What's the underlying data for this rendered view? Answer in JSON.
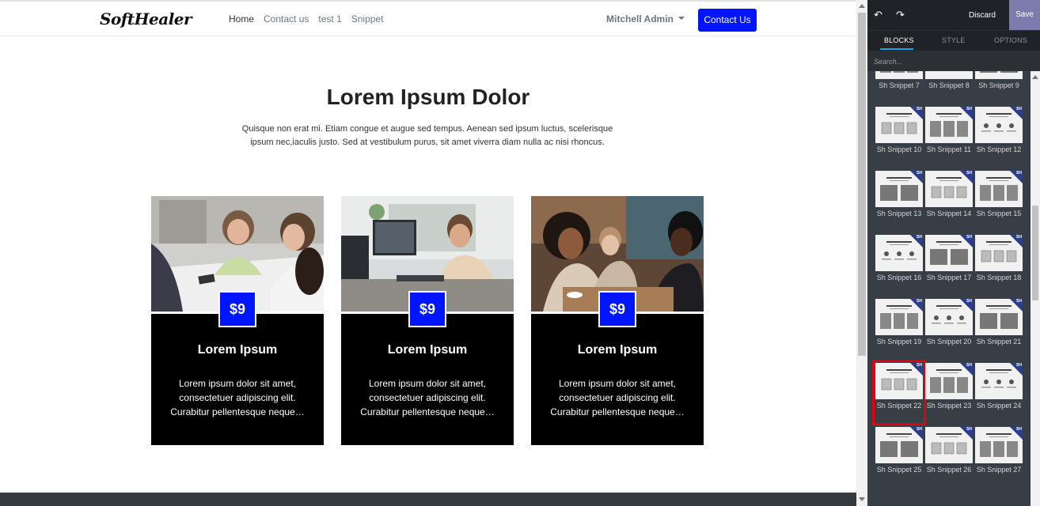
{
  "navbar": {
    "logo": "SoftHealer",
    "links": [
      "Home",
      "Contact us",
      "test 1",
      "Snippet"
    ],
    "user": "Mitchell Admin",
    "cta": "Contact Us"
  },
  "hero": {
    "title": "Lorem Ipsum Dolor",
    "text": "Quisque non erat mi. Etiam congue et augue sed tempus. Aenean sed ipsum luctus, scelerisque ipsum nec,iaculis justo. Sed at vestibulum purus, sit amet viverra diam nulla ac nisi rhoncus."
  },
  "cards": [
    {
      "price": "$9",
      "title": "Lorem Ipsum",
      "text": "Lorem ipsum dolor sit amet, consectetuer adipiscing elit. Curabitur pellentesque neque…"
    },
    {
      "price": "$9",
      "title": "Lorem Ipsum",
      "text": "Lorem ipsum dolor sit amet, consectetuer adipiscing elit. Curabitur pellentesque neque…"
    },
    {
      "price": "$9",
      "title": "Lorem Ipsum",
      "text": "Lorem ipsum dolor sit amet, consectetuer adipiscing elit. Curabitur pellentesque neque…"
    }
  ],
  "editor": {
    "discard": "Discard",
    "save": "Save",
    "tabs": [
      "BLOCKS",
      "STYLE",
      "OPTIONS"
    ],
    "search_placeholder": "Search...",
    "badge": "SH",
    "snippets": [
      "Sh Snippet 7",
      "Sh Snippet 8",
      "Sh Snippet 9",
      "Sh Snippet 10",
      "Sh Snippet 11",
      "Sh Snippet 12",
      "Sh Snippet 13",
      "Sh Snippet 14",
      "Sh Snippet 15",
      "Sh Snippet 16",
      "Sh Snippet 17",
      "Sh Snippet 18",
      "Sh Snippet 19",
      "Sh Snippet 20",
      "Sh Snippet 21",
      "Sh Snippet 22",
      "Sh Snippet 23",
      "Sh Snippet 24",
      "Sh Snippet 25",
      "Sh Snippet 26",
      "Sh Snippet 27"
    ],
    "selected_snippet": "Sh Snippet 22"
  },
  "colors": {
    "brand_blue": "#0015ff",
    "editor_bg": "#383e45",
    "save_bg": "#7c7bad",
    "selected_outline": "#e3000f"
  }
}
